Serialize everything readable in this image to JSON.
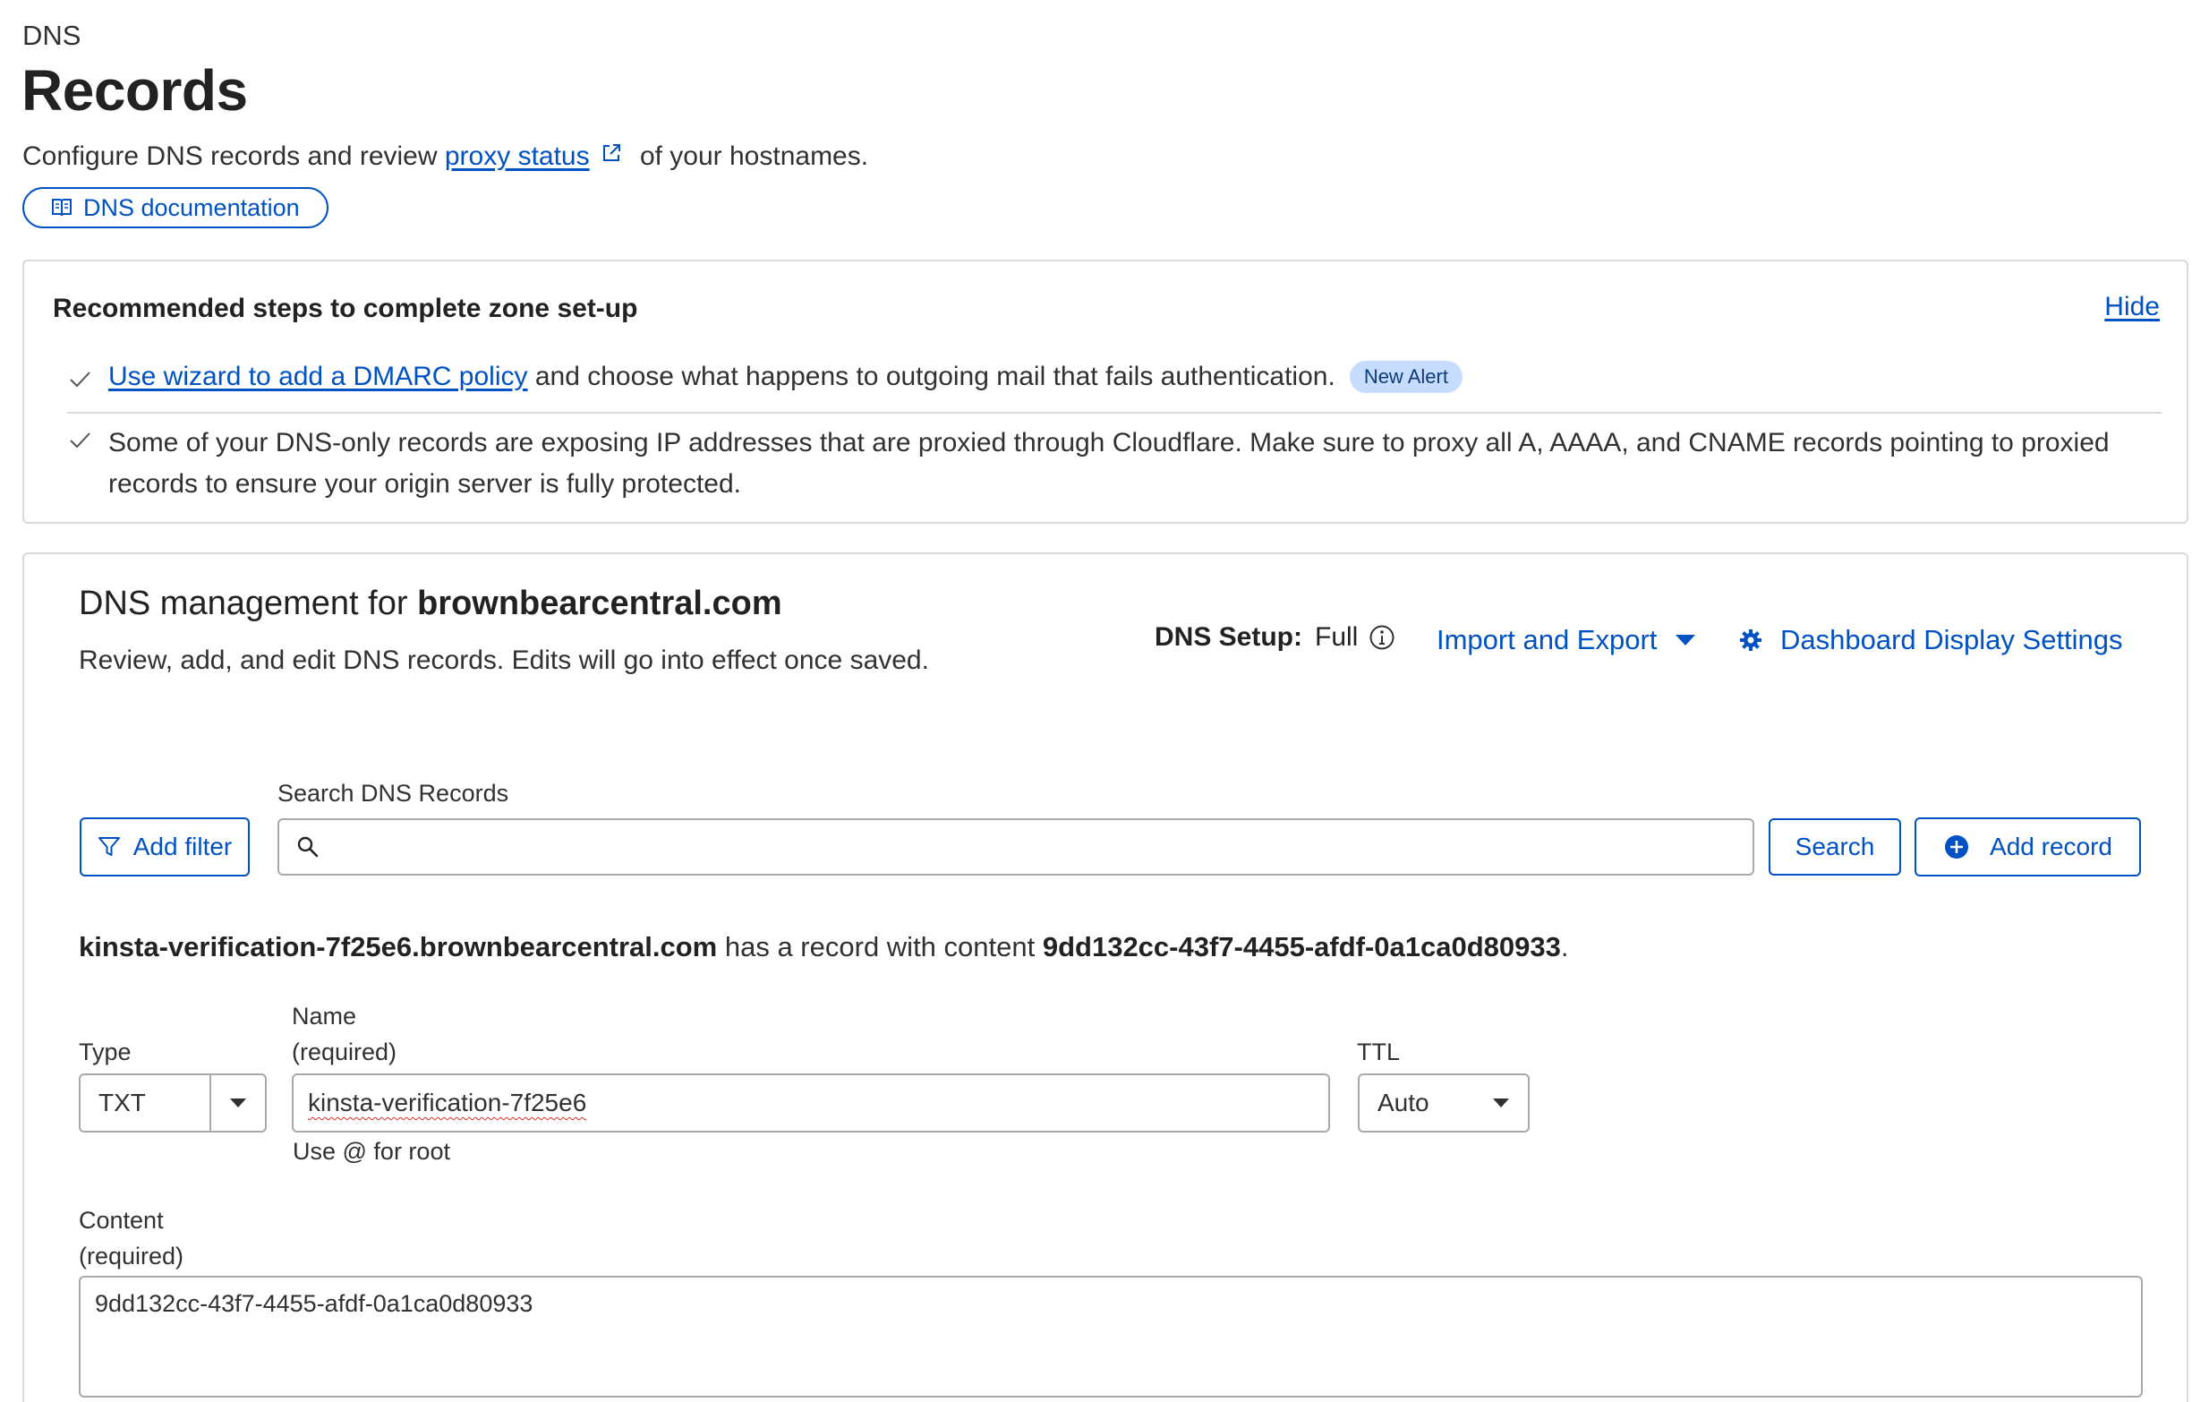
{
  "header": {
    "breadcrumb": "DNS",
    "title": "Records",
    "desc_before": "Configure DNS records and review ",
    "desc_link": "proxy status",
    "desc_after": " of your hostnames.",
    "doc_button": "DNS documentation"
  },
  "recommended": {
    "title": "Recommended steps to complete zone set-up",
    "hide": "Hide",
    "step1_link": "Use wizard to add a DMARC policy",
    "step1_text": " and choose what happens to outgoing mail that fails authentication.",
    "step1_badge": "New Alert",
    "step2_text": "Some of your DNS-only records are exposing IP addresses that are proxied through Cloudflare. Make sure to proxy all A, AAAA, and CNAME records pointing to proxied records to ensure your origin server is fully protected."
  },
  "management": {
    "title_prefix": "DNS management for ",
    "domain": "brownbearcentral.com",
    "desc": "Review, add, and edit DNS records. Edits will go into effect once saved.",
    "dns_setup_label": "DNS Setup:",
    "dns_setup_value": "Full",
    "import_export": "Import and Export",
    "display_settings": "Dashboard Display Settings",
    "search_label": "Search DNS Records",
    "search_value": "",
    "add_filter": "Add filter",
    "search_button": "Search",
    "add_record": "Add record"
  },
  "record": {
    "summary_host": "kinsta-verification-7f25e6.brownbearcentral.com",
    "summary_mid": " has a record with content ",
    "summary_content": "9dd132cc-43f7-4455-afdf-0a1ca0d80933",
    "summary_end": ".",
    "type_label": "Type",
    "type_value": "TXT",
    "name_label_1": "Name",
    "name_label_2": "(required)",
    "name_value": "kinsta-verification-7f25e6",
    "name_help": "Use @ for root",
    "ttl_label": "TTL",
    "ttl_value": "Auto",
    "content_label_1": "Content",
    "content_label_2": "(required)",
    "content_value": "9dd132cc-43f7-4455-afdf-0a1ca0d80933"
  },
  "colors": {
    "accent": "#0051c3",
    "badge_bg": "#c7ddff",
    "border": "#d9d9d9",
    "text": "#313131"
  },
  "icons": {
    "external_link": "external-link-icon",
    "book": "book-icon",
    "check": "check-icon",
    "info": "info-icon",
    "caret": "caret-down-icon",
    "gear": "gear-icon",
    "filter": "filter-icon",
    "search": "search-icon",
    "plus": "plus-circle-icon"
  }
}
